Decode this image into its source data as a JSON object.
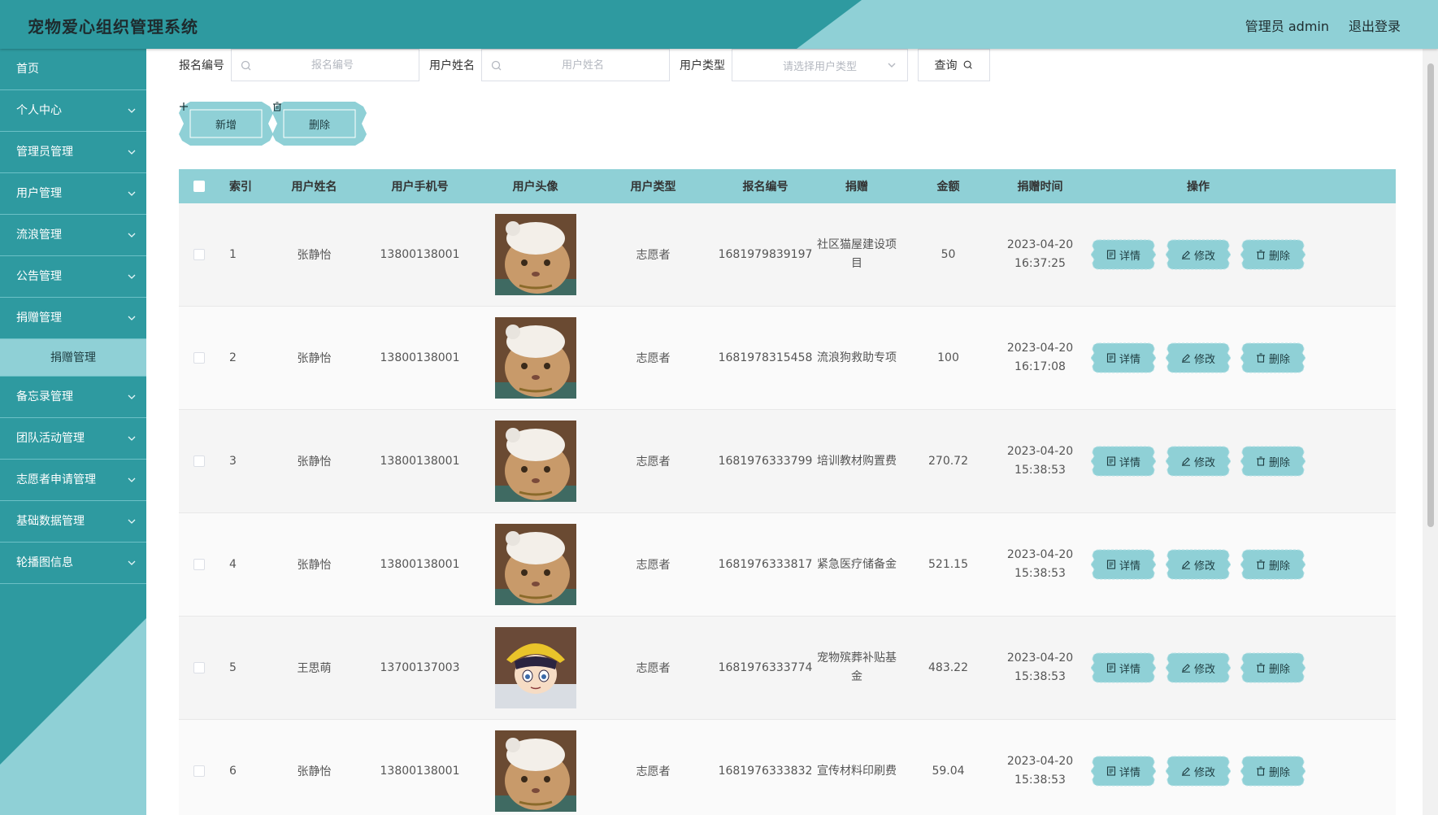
{
  "app": {
    "title": "宠物爱心组织管理系统"
  },
  "header": {
    "admin_label": "管理员 admin",
    "logout_label": "退出登录"
  },
  "sidebar": {
    "items": [
      {
        "label": "首页",
        "expandable": false
      },
      {
        "label": "个人中心",
        "expandable": true
      },
      {
        "label": "管理员管理",
        "expandable": true
      },
      {
        "label": "用户管理",
        "expandable": true
      },
      {
        "label": "流浪管理",
        "expandable": true
      },
      {
        "label": "公告管理",
        "expandable": true
      },
      {
        "label": "捐赠管理",
        "expandable": true,
        "expanded": true
      }
    ],
    "active_sub": "捐赠管理",
    "items_after": [
      {
        "label": "备忘录管理"
      },
      {
        "label": "团队活动管理"
      },
      {
        "label": "志愿者申请管理"
      },
      {
        "label": "基础数据管理"
      },
      {
        "label": "轮播图信息"
      }
    ]
  },
  "search": {
    "code_label": "报名编号",
    "code_placeholder": "报名编号",
    "name_label": "用户姓名",
    "name_placeholder": "用户姓名",
    "type_label": "用户类型",
    "type_placeholder": "请选择用户类型",
    "query_label": "查询"
  },
  "actions": {
    "add_label": "新增",
    "delete_label": "删除"
  },
  "table": {
    "headers": [
      "索引",
      "用户姓名",
      "用户手机号",
      "用户头像",
      "用户类型",
      "报名编号",
      "捐赠",
      "金额",
      "捐赠时间",
      "操作"
    ],
    "rows": [
      {
        "index": "1",
        "name": "张静怡",
        "phone": "13800138001",
        "avatar": "cat",
        "type": "志愿者",
        "code": "1681979839197",
        "donation": "社区猫屋建设项目",
        "amount": "50",
        "time": "2023-04-20 16:37:25"
      },
      {
        "index": "2",
        "name": "张静怡",
        "phone": "13800138001",
        "avatar": "cat",
        "type": "志愿者",
        "code": "1681978315458",
        "donation": "流浪狗救助专项",
        "amount": "100",
        "time": "2023-04-20 16:17:08"
      },
      {
        "index": "3",
        "name": "张静怡",
        "phone": "13800138001",
        "avatar": "cat",
        "type": "志愿者",
        "code": "1681976333799",
        "donation": "培训教材购置费",
        "amount": "270.72",
        "time": "2023-04-20 15:38:53"
      },
      {
        "index": "4",
        "name": "张静怡",
        "phone": "13800138001",
        "avatar": "cat",
        "type": "志愿者",
        "code": "1681976333817",
        "donation": "紧急医疗储备金",
        "amount": "521.15",
        "time": "2023-04-20 15:38:53"
      },
      {
        "index": "5",
        "name": "王思萌",
        "phone": "13700137003",
        "avatar": "anime",
        "type": "志愿者",
        "code": "1681976333774",
        "donation": "宠物殡葬补贴基金",
        "amount": "483.22",
        "time": "2023-04-20 15:38:53"
      },
      {
        "index": "6",
        "name": "张静怡",
        "phone": "13800138001",
        "avatar": "cat",
        "type": "志愿者",
        "code": "1681976333832",
        "donation": "宣传材料印刷费",
        "amount": "59.04",
        "time": "2023-04-20 15:38:53"
      }
    ],
    "row_ops": {
      "detail_label": "详情",
      "edit_label": "修改",
      "delete_label": "删除"
    }
  },
  "colors": {
    "primary": "#2e9aa0",
    "accent": "#8fd0d6",
    "text": "#333333"
  }
}
